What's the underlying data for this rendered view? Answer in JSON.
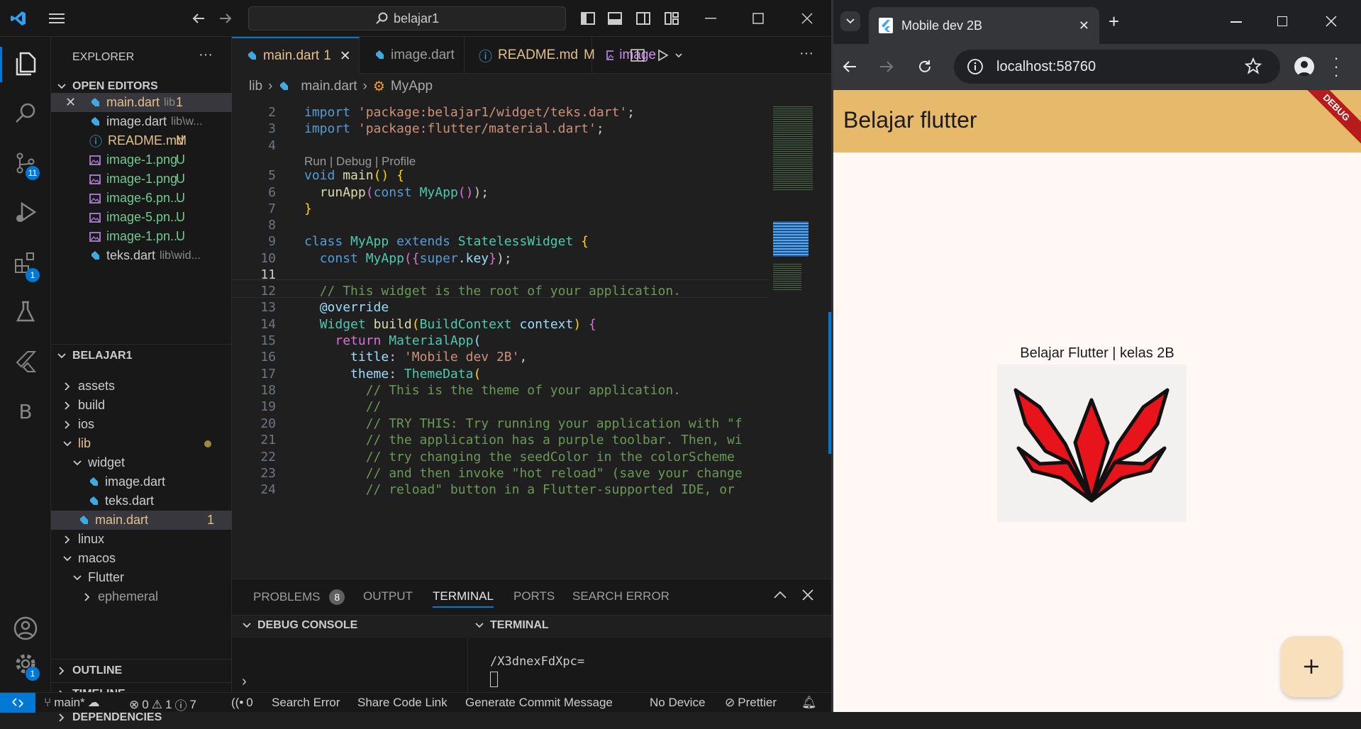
{
  "vscode": {
    "command_center": "belajar1",
    "explorer_title": "EXPLORER",
    "open_editors_title": "OPEN EDITORS",
    "open_editors": [
      {
        "name": "main.dart",
        "hint": "lib",
        "badge": "1",
        "color": "#e2c08d"
      },
      {
        "name": "image.dart",
        "hint": "lib\\w...",
        "badge": "",
        "color": "#ccc"
      },
      {
        "name": "README.md",
        "hint": "",
        "badge": "M",
        "color": "#e2c08d"
      },
      {
        "name": "image-1.png",
        "hint": "",
        "badge": "U",
        "color": "#73c991"
      },
      {
        "name": "image-1.png",
        "hint": "",
        "badge": "U",
        "color": "#73c991"
      },
      {
        "name": "image-6.pn...",
        "hint": "",
        "badge": "U",
        "color": "#73c991"
      },
      {
        "name": "image-5.pn...",
        "hint": "",
        "badge": "U",
        "color": "#73c991"
      },
      {
        "name": "image-1.pn...",
        "hint": "",
        "badge": "U",
        "color": "#73c991"
      },
      {
        "name": "teks.dart",
        "hint": "lib\\wid...",
        "badge": "",
        "color": "#ccc"
      }
    ],
    "project_title": "BELAJAR1",
    "tree": [
      "assets",
      "build",
      "ios",
      "lib",
      "widget",
      "image.dart",
      "teks.dart",
      "main.dart",
      "linux",
      "macos",
      "Flutter",
      "ephemeral"
    ],
    "main_badge": "1",
    "outline": "OUTLINE",
    "timeline": "TIMELINE",
    "dependencies": "DEPENDENCIES",
    "tabs": [
      "main.dart",
      "image.dart",
      "README.md",
      "image"
    ],
    "tab_main_badge": "1",
    "tab_readme_badge": "M",
    "breadcrumb": [
      "lib",
      "main.dart",
      "MyApp"
    ],
    "codelens": "Run | Debug | Profile",
    "line_numbers": [
      "2",
      "3",
      "4",
      "5",
      "6",
      "7",
      "8",
      "9",
      "10",
      "11",
      "12",
      "13",
      "14",
      "15",
      "16",
      "17",
      "18",
      "19",
      "20",
      "21",
      "22",
      "23",
      "24"
    ],
    "panel_tabs": [
      "PROBLEMS",
      "OUTPUT",
      "TERMINAL",
      "PORTS",
      "SEARCH ERROR"
    ],
    "problems_count": "8",
    "debug_console": "DEBUG CONSOLE",
    "terminal": "TERMINAL",
    "terminal_text": "/X3dnexFdXpc=",
    "status": {
      "branch": "main*",
      "errors": "0",
      "warnings": "1",
      "info": "7",
      "ports": "0",
      "search_error": "Search Error",
      "share": "Share Code Link",
      "commit": "Generate Commit Message",
      "device": "No Device",
      "prettier": "Prettier"
    },
    "activity_badges": {
      "scm": "11",
      "extensions": "1",
      "settings": "1"
    }
  },
  "chrome": {
    "tab_title": "Mobile dev 2B",
    "url": "localhost:58760",
    "app_title": "Belajar flutter",
    "debug_banner": "DEBUG",
    "content_text": "Belajar Flutter  | kelas 2B"
  },
  "colors": {
    "accent": "#0078d4",
    "appbar": "#e7b96a",
    "fab": "#f9e0bd",
    "logo_red": "#e8141b"
  }
}
